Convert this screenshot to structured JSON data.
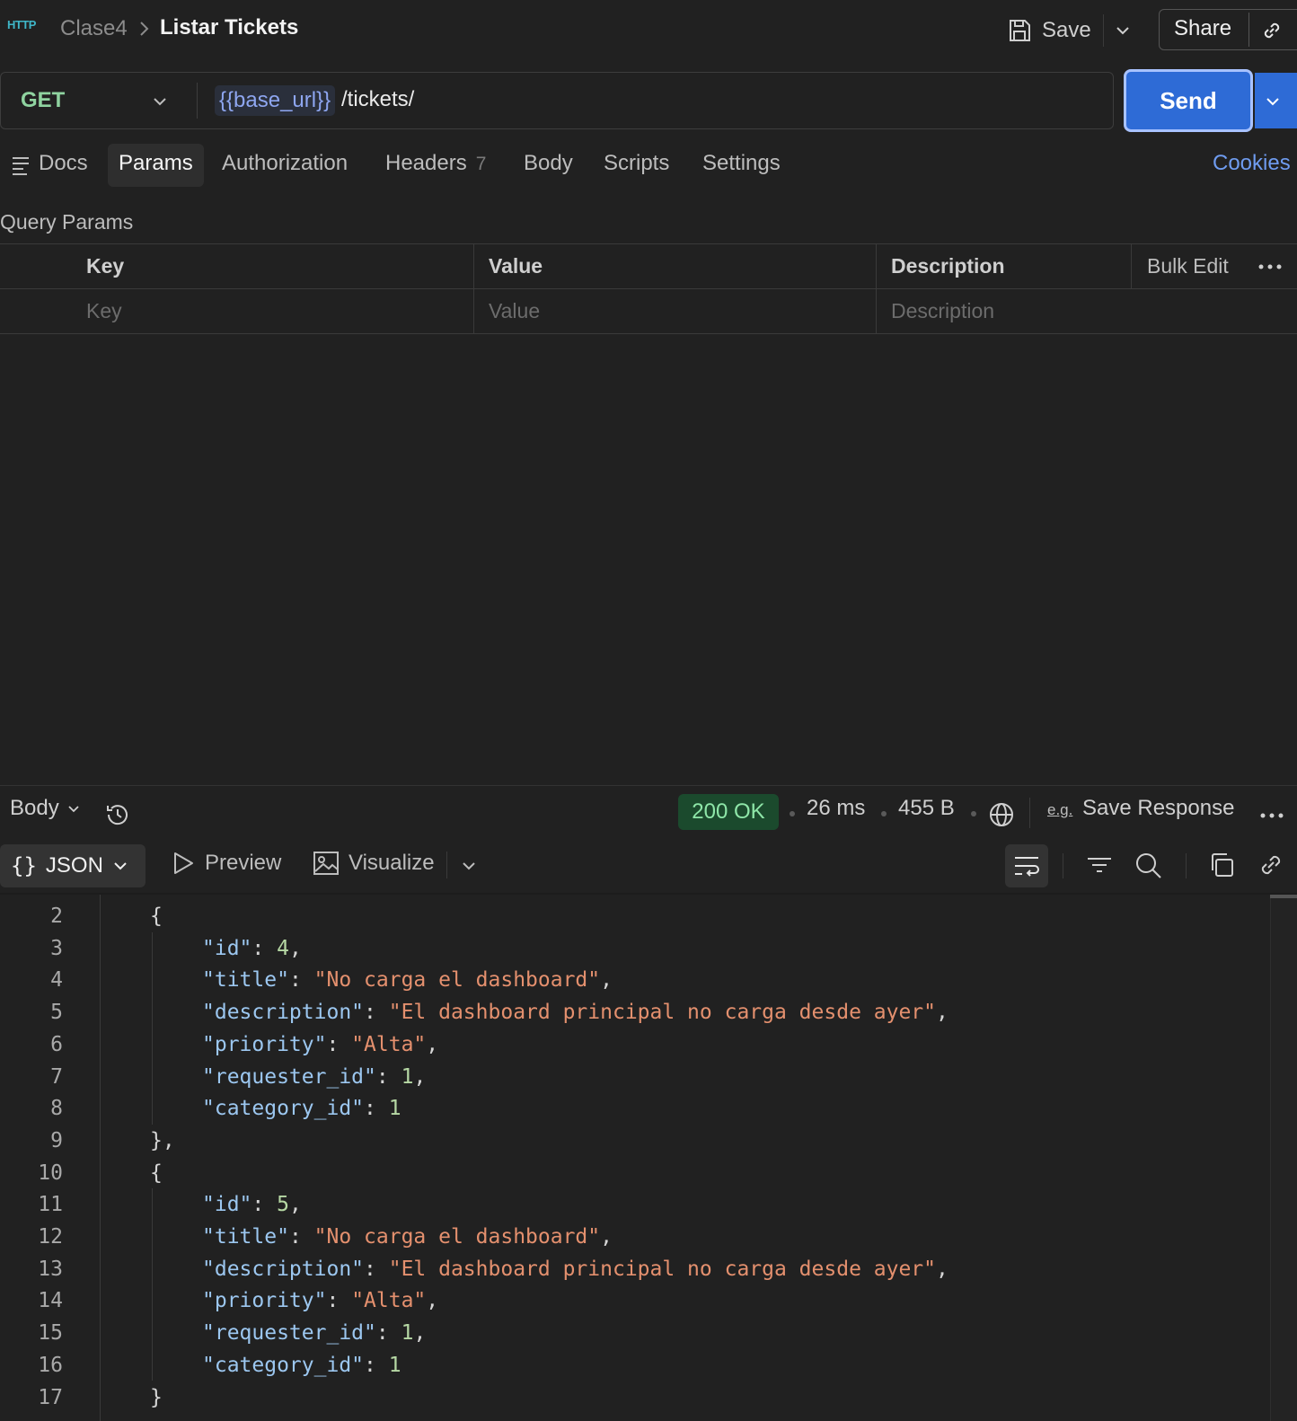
{
  "header": {
    "protocol_icon": "HTTP",
    "breadcrumb_parent": "Clase4",
    "title": "Listar Tickets",
    "save_label": "Save",
    "share_label": "Share"
  },
  "request": {
    "method": "GET",
    "url_variable": "{{base_url}}",
    "url_path": "/tickets/",
    "send_label": "Send"
  },
  "tabs": {
    "docs": "Docs",
    "params": "Params",
    "authorization": "Authorization",
    "headers": "Headers",
    "headers_count": "7",
    "body": "Body",
    "scripts": "Scripts",
    "settings": "Settings",
    "cookies": "Cookies"
  },
  "query_params": {
    "title": "Query Params",
    "columns": [
      "Key",
      "Value",
      "Description"
    ],
    "placeholders": [
      "Key",
      "Value",
      "Description"
    ],
    "bulk_edit": "Bulk Edit"
  },
  "response": {
    "section_label": "Body",
    "status": "200 OK",
    "time": "26 ms",
    "size": "455 B",
    "save_response": "Save Response",
    "view_json": "JSON",
    "view_preview": "Preview",
    "view_visualize": "Visualize"
  },
  "code_lines": [
    {
      "n": "2",
      "indent": 1,
      "tokens": [
        {
          "t": "p",
          "v": "{"
        }
      ]
    },
    {
      "n": "3",
      "indent": 2,
      "tokens": [
        {
          "t": "k",
          "v": "\"id\""
        },
        {
          "t": "p",
          "v": ": "
        },
        {
          "t": "n",
          "v": "4"
        },
        {
          "t": "p",
          "v": ","
        }
      ]
    },
    {
      "n": "4",
      "indent": 2,
      "tokens": [
        {
          "t": "k",
          "v": "\"title\""
        },
        {
          "t": "p",
          "v": ": "
        },
        {
          "t": "s",
          "v": "\"No carga el dashboard\""
        },
        {
          "t": "p",
          "v": ","
        }
      ]
    },
    {
      "n": "5",
      "indent": 2,
      "tokens": [
        {
          "t": "k",
          "v": "\"description\""
        },
        {
          "t": "p",
          "v": ": "
        },
        {
          "t": "s",
          "v": "\"El dashboard principal no carga desde ayer\""
        },
        {
          "t": "p",
          "v": ","
        }
      ]
    },
    {
      "n": "6",
      "indent": 2,
      "tokens": [
        {
          "t": "k",
          "v": "\"priority\""
        },
        {
          "t": "p",
          "v": ": "
        },
        {
          "t": "s",
          "v": "\"Alta\""
        },
        {
          "t": "p",
          "v": ","
        }
      ]
    },
    {
      "n": "7",
      "indent": 2,
      "tokens": [
        {
          "t": "k",
          "v": "\"requester_id\""
        },
        {
          "t": "p",
          "v": ": "
        },
        {
          "t": "n",
          "v": "1"
        },
        {
          "t": "p",
          "v": ","
        }
      ]
    },
    {
      "n": "8",
      "indent": 2,
      "tokens": [
        {
          "t": "k",
          "v": "\"category_id\""
        },
        {
          "t": "p",
          "v": ": "
        },
        {
          "t": "n",
          "v": "1"
        }
      ]
    },
    {
      "n": "9",
      "indent": 1,
      "tokens": [
        {
          "t": "p",
          "v": "},"
        }
      ]
    },
    {
      "n": "10",
      "indent": 1,
      "tokens": [
        {
          "t": "p",
          "v": "{"
        }
      ]
    },
    {
      "n": "11",
      "indent": 2,
      "tokens": [
        {
          "t": "k",
          "v": "\"id\""
        },
        {
          "t": "p",
          "v": ": "
        },
        {
          "t": "n",
          "v": "5"
        },
        {
          "t": "p",
          "v": ","
        }
      ]
    },
    {
      "n": "12",
      "indent": 2,
      "tokens": [
        {
          "t": "k",
          "v": "\"title\""
        },
        {
          "t": "p",
          "v": ": "
        },
        {
          "t": "s",
          "v": "\"No carga el dashboard\""
        },
        {
          "t": "p",
          "v": ","
        }
      ]
    },
    {
      "n": "13",
      "indent": 2,
      "tokens": [
        {
          "t": "k",
          "v": "\"description\""
        },
        {
          "t": "p",
          "v": ": "
        },
        {
          "t": "s",
          "v": "\"El dashboard principal no carga desde ayer\""
        },
        {
          "t": "p",
          "v": ","
        }
      ]
    },
    {
      "n": "14",
      "indent": 2,
      "tokens": [
        {
          "t": "k",
          "v": "\"priority\""
        },
        {
          "t": "p",
          "v": ": "
        },
        {
          "t": "s",
          "v": "\"Alta\""
        },
        {
          "t": "p",
          "v": ","
        }
      ]
    },
    {
      "n": "15",
      "indent": 2,
      "tokens": [
        {
          "t": "k",
          "v": "\"requester_id\""
        },
        {
          "t": "p",
          "v": ": "
        },
        {
          "t": "n",
          "v": "1"
        },
        {
          "t": "p",
          "v": ","
        }
      ]
    },
    {
      "n": "16",
      "indent": 2,
      "tokens": [
        {
          "t": "k",
          "v": "\"category_id\""
        },
        {
          "t": "p",
          "v": ": "
        },
        {
          "t": "n",
          "v": "1"
        }
      ]
    },
    {
      "n": "17",
      "indent": 1,
      "tokens": [
        {
          "t": "p",
          "v": "}"
        }
      ]
    }
  ],
  "colors": {
    "accent": "#2e6bd6",
    "status_ok_bg": "#1b4a2d",
    "status_ok_text": "#8ee6a8",
    "method_get": "#8fd3a0",
    "link": "#6f9cf0"
  },
  "icons": [
    "http-icon",
    "chevron-right-icon",
    "save-icon",
    "chevron-down-icon",
    "link-icon",
    "docs-icon",
    "more-icon",
    "history-icon",
    "globe-icon",
    "example-icon",
    "play-icon",
    "image-icon",
    "wrap-icon",
    "filter-icon",
    "search-icon",
    "copy-icon"
  ]
}
